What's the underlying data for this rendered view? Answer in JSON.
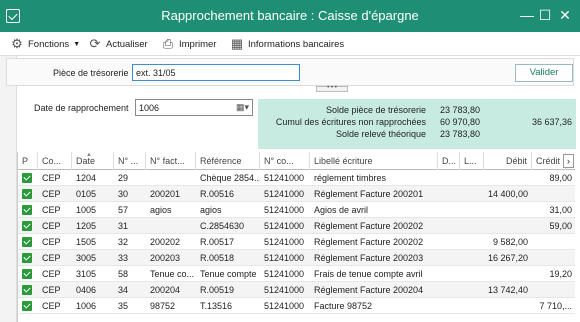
{
  "window": {
    "title": "Rapprochement bancaire : Caisse d'épargne",
    "icons": {
      "app": "check-window-icon",
      "minimize": "minimize-icon",
      "maximize": "maximize-icon",
      "close": "close-icon"
    }
  },
  "toolbar": {
    "fonctions": "Fonctions",
    "actualiser": "Actualiser",
    "imprimer": "Imprimer",
    "infos": "Informations bancaires"
  },
  "form": {
    "piece_label": "Pièce de trésorerie",
    "piece_value": "ext. 31/05",
    "valider": "Valider",
    "date_label": "Date de rapprochement",
    "date_value": "1006",
    "splitter": "• • •"
  },
  "summary": {
    "solde_piece_label": "Solde pièce de trésorerie",
    "solde_piece_value": "23 783,80",
    "cumul_label": "Cumul des écritures non rapprochées",
    "cumul_value": "60 970,80",
    "cumul_value2": "36 637,36",
    "solde_releve_label": "Solde relevé théorique",
    "solde_releve_value": "23 783,80"
  },
  "table": {
    "headers": [
      "P",
      "Co...",
      "Date",
      "N° ...",
      "N° fact...",
      "Référence",
      "N° co...",
      "Libellé écriture",
      "D...",
      "L...",
      "Débit",
      "Crédit"
    ],
    "rows": [
      {
        "co": "CEP",
        "date": "1204",
        "no": "29",
        "fact": "",
        "ref": "Chèque 2854...",
        "compte": "51241000",
        "libelle": "réglement timbres",
        "debit": "",
        "credit": "89,00"
      },
      {
        "co": "CEP",
        "date": "0105",
        "no": "30",
        "fact": "200201",
        "ref": "R.00516",
        "compte": "51241000",
        "libelle": "Réglement Facture 200201",
        "debit": "14 400,00",
        "credit": ""
      },
      {
        "co": "CEP",
        "date": "1005",
        "no": "57",
        "fact": "agios",
        "ref": "agios",
        "compte": "51241000",
        "libelle": "Agios de avril",
        "debit": "",
        "credit": "31,00"
      },
      {
        "co": "CEP",
        "date": "1205",
        "no": "31",
        "fact": "",
        "ref": "C.2854630",
        "compte": "51241000",
        "libelle": "Réglement Facture 200202",
        "debit": "",
        "credit": "59,00"
      },
      {
        "co": "CEP",
        "date": "1505",
        "no": "32",
        "fact": "200202",
        "ref": "R.00517",
        "compte": "51241000",
        "libelle": "Réglement Facture 200202",
        "debit": "9 582,00",
        "credit": ""
      },
      {
        "co": "CEP",
        "date": "3005",
        "no": "33",
        "fact": "200203",
        "ref": "R.00518",
        "compte": "51241000",
        "libelle": "Réglement Facture 200203",
        "debit": "16 267,20",
        "credit": ""
      },
      {
        "co": "CEP",
        "date": "3105",
        "no": "58",
        "fact": "Tenue co...",
        "ref": "Tenue compte",
        "compte": "51241000",
        "libelle": "Frais de tenue compte avril",
        "debit": "",
        "credit": "19,20"
      },
      {
        "co": "CEP",
        "date": "0406",
        "no": "34",
        "fact": "200204",
        "ref": "R.00519",
        "compte": "51241000",
        "libelle": "Réglement Facture 200204",
        "debit": "13 742,40",
        "credit": ""
      },
      {
        "co": "CEP",
        "date": "1006",
        "no": "35",
        "fact": "98752",
        "ref": "T.13516",
        "compte": "51241000",
        "libelle": "Facture 98752",
        "debit": "",
        "credit": "7 710,..."
      }
    ]
  }
}
